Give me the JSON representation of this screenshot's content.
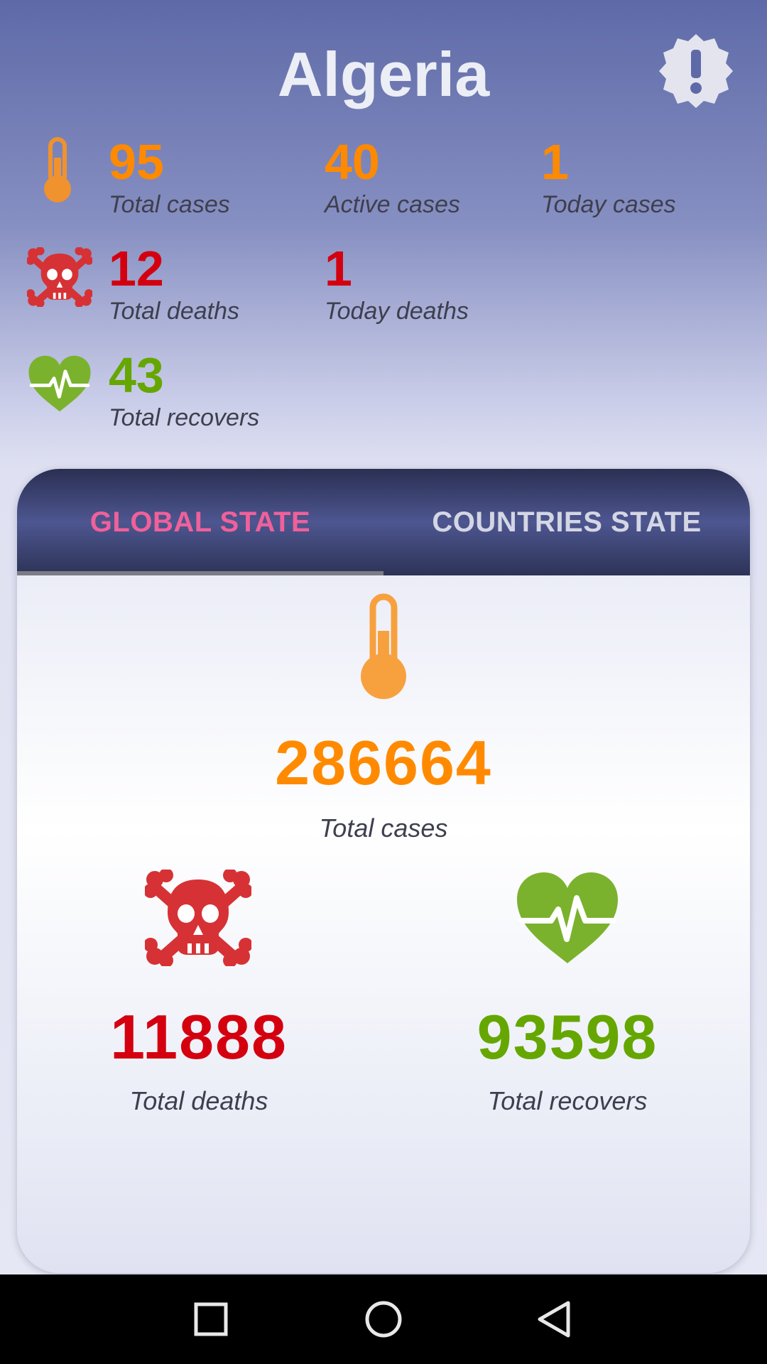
{
  "header": {
    "country": "Algeria",
    "alert_icon": "alert-badge-icon"
  },
  "country_stats": {
    "total_cases": {
      "value": "95",
      "label": "Total cases"
    },
    "active_cases": {
      "value": "40",
      "label": "Active cases"
    },
    "today_cases": {
      "value": "1",
      "label": "Today cases"
    },
    "total_deaths": {
      "value": "12",
      "label": "Total deaths"
    },
    "today_deaths": {
      "value": "1",
      "label": "Today deaths"
    },
    "total_recovers": {
      "value": "43",
      "label": "Total recovers"
    }
  },
  "tabs": {
    "global": "GLOBAL STATE",
    "countries": "COUNTRIES STATE",
    "selected": "GLOBAL STATE"
  },
  "global_stats": {
    "total_cases": {
      "value": "286664",
      "label": "Total cases"
    },
    "total_deaths": {
      "value": "11888",
      "label": "Total deaths"
    },
    "total_recovers": {
      "value": "93598",
      "label": "Total recovers"
    }
  },
  "colors": {
    "cases": "#ff8a00",
    "deaths": "#d4000f",
    "recovers": "#65a700",
    "active_tab": "#f0609a"
  },
  "icons": {
    "cases": "thermometer-icon",
    "deaths": "skull-crossbones-icon",
    "recovers": "heart-pulse-icon"
  },
  "navigation": {
    "recents": "square-icon",
    "home": "circle-icon",
    "back": "triangle-back-icon"
  }
}
